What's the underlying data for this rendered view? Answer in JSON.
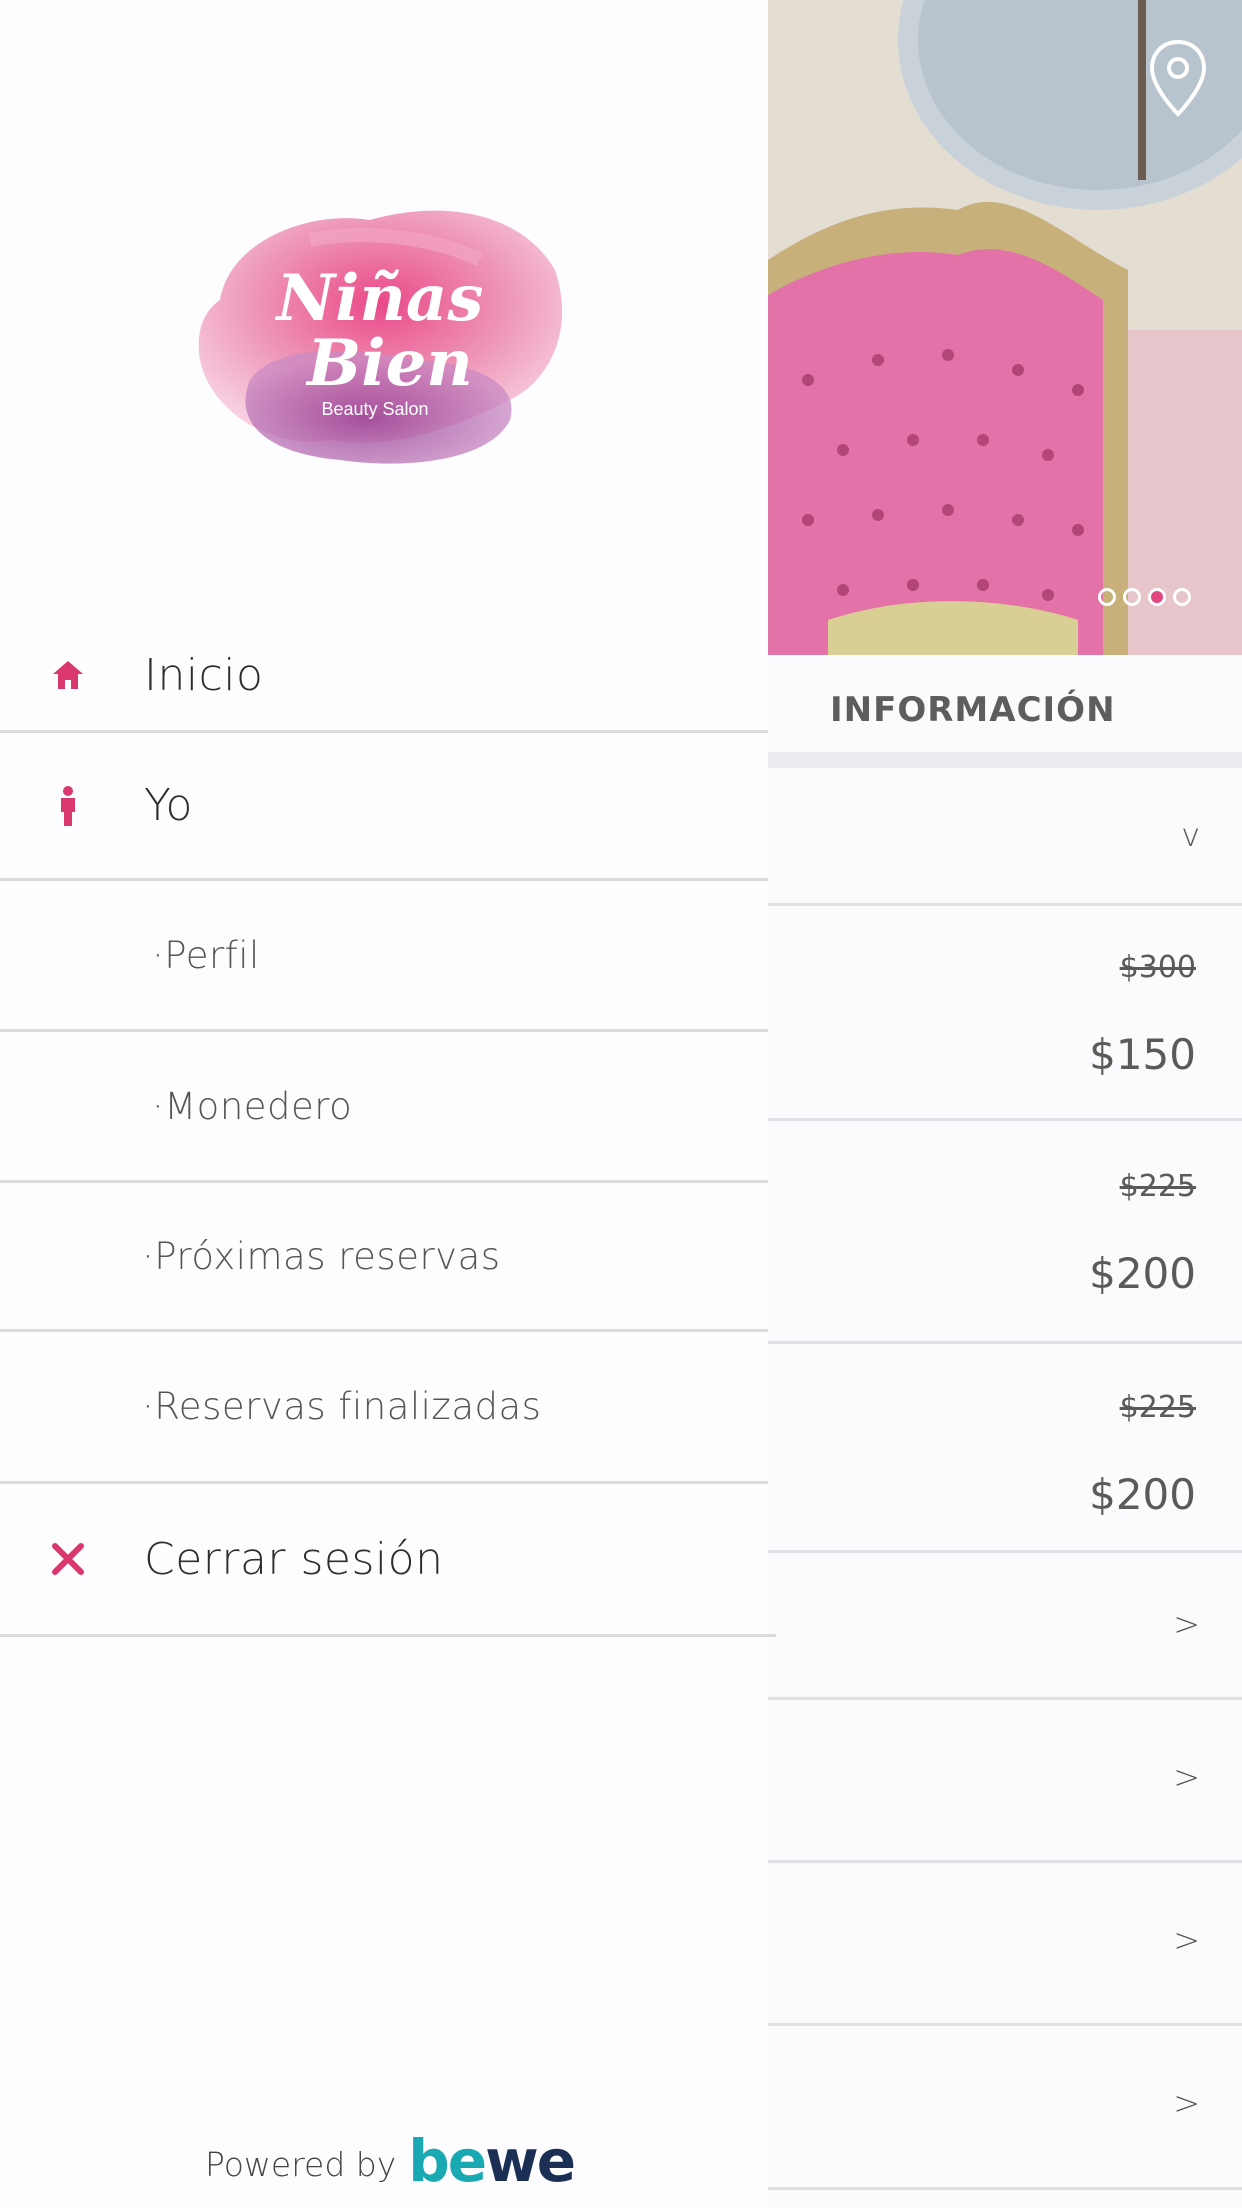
{
  "drawer": {
    "logo": {
      "line1": "Niñas",
      "line2": "Bien",
      "tagline": "Beauty Salon"
    },
    "items": [
      {
        "label": "Inicio",
        "icon": "home-icon"
      },
      {
        "label": "Yo",
        "icon": "person-icon"
      },
      {
        "label": "·Perfil"
      },
      {
        "label": "·Monedero"
      },
      {
        "label": "·Próximas reservas"
      },
      {
        "label": "·Reservas finalizadas"
      },
      {
        "label": "Cerrar sesión",
        "icon": "close-icon"
      }
    ],
    "powered_by": "Powered by",
    "brand": {
      "part1": "be",
      "part2": "we"
    }
  },
  "main": {
    "tab_label": "INFORMACIÓN",
    "carousel": {
      "count": 4,
      "active_index": 2
    },
    "expand_glyph": "v",
    "prices": [
      {
        "old": "$300",
        "new": "$150"
      },
      {
        "old": "$225",
        "new": "$200"
      },
      {
        "old": "$225",
        "new": "$200"
      }
    ],
    "chevron": ">"
  },
  "colors": {
    "accent": "#d9376e",
    "bewe_teal": "#19a9b2",
    "bewe_navy": "#1b2f55"
  }
}
